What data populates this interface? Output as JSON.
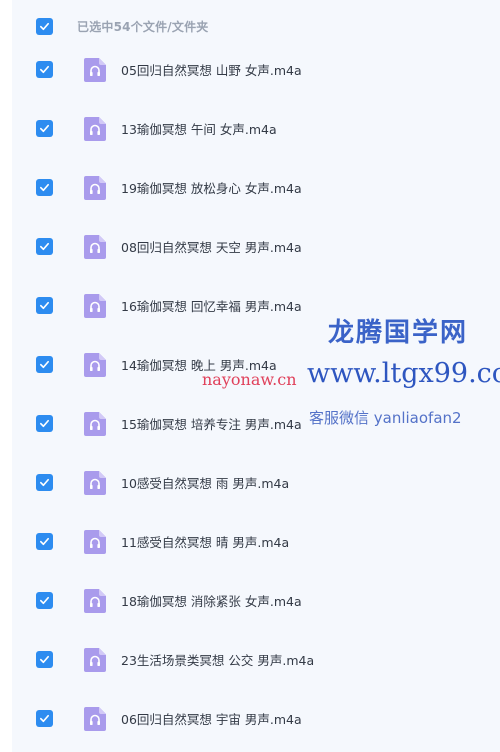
{
  "colors": {
    "accent": "#2d8cf0",
    "file_icon": "#a99bec",
    "panel_bg": "#f5f8fd"
  },
  "header": {
    "selection_text": "已选中54个文件/文件夹",
    "checked": true
  },
  "files": [
    {
      "name": "05回归自然冥想 山野 女声.m4a",
      "checked": true,
      "icon": "audio-file-icon"
    },
    {
      "name": "13瑜伽冥想 午间 女声.m4a",
      "checked": true,
      "icon": "audio-file-icon"
    },
    {
      "name": "19瑜伽冥想 放松身心 女声.m4a",
      "checked": true,
      "icon": "audio-file-icon"
    },
    {
      "name": "08回归自然冥想 天空 男声.m4a",
      "checked": true,
      "icon": "audio-file-icon"
    },
    {
      "name": "16瑜伽冥想 回忆幸福 男声.m4a",
      "checked": true,
      "icon": "audio-file-icon"
    },
    {
      "name": "14瑜伽冥想 晚上 男声.m4a",
      "checked": true,
      "icon": "audio-file-icon"
    },
    {
      "name": "15瑜伽冥想 培养专注 男声.m4a",
      "checked": true,
      "icon": "audio-file-icon"
    },
    {
      "name": "10感受自然冥想 雨 男声.m4a",
      "checked": true,
      "icon": "audio-file-icon"
    },
    {
      "name": "11感受自然冥想 晴 男声.m4a",
      "checked": true,
      "icon": "audio-file-icon"
    },
    {
      "name": "18瑜伽冥想 消除紧张 女声.m4a",
      "checked": true,
      "icon": "audio-file-icon"
    },
    {
      "name": "23生活场景类冥想 公交 男声.m4a",
      "checked": true,
      "icon": "audio-file-icon"
    },
    {
      "name": "06回归自然冥想 宇宙 男声.m4a",
      "checked": true,
      "icon": "audio-file-icon"
    }
  ],
  "watermark": {
    "title": "龙腾国学网",
    "url": "www.ltgx99.co",
    "red_text": "nayonaw.cn",
    "contact": "客服微信 yanliaofan2"
  }
}
